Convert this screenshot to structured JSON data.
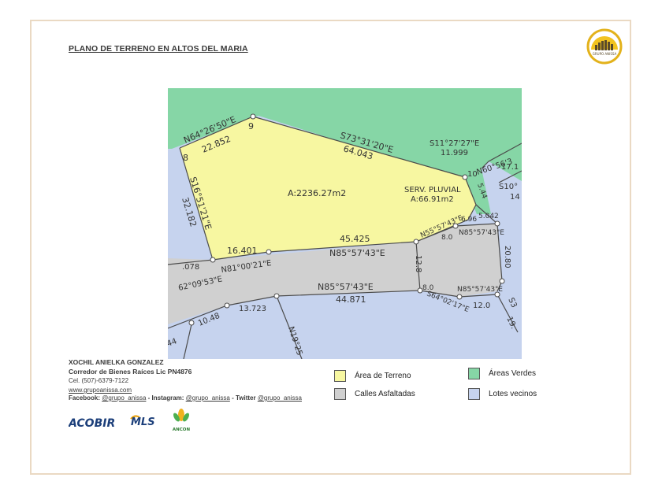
{
  "document": {
    "title": "PLANO DE TERRENO EN ALTOS DEL MARIA",
    "logo_text": "GRUPO ANISSA"
  },
  "map": {
    "colors": {
      "terreno": "#f7f7a1",
      "verdes": "#86d6a6",
      "calles": "#d0d0d0",
      "vecinos": "#c6d3ee",
      "lines": "#4b4b4b"
    },
    "area_label": "A:2236.27m2",
    "serv_pluvial": "SERV. PLUVIAL",
    "serv_area": "A:66.91m2",
    "labels": {
      "n642650": "N64°26'50\"E",
      "d22852": "22.852",
      "p9": "9",
      "p8": "8",
      "s733120": "S73°31'20\"E",
      "d64043": "64.043",
      "s112727": "S11°27'27\"E",
      "d11999": "11.999",
      "p10": "10",
      "n6056": "N60°56'3",
      "d171": "17.1",
      "s10": "S10°",
      "d14": "14",
      "d544": "5.44",
      "d5042": "5.042",
      "s165121": "S16°51'21\"E",
      "d32182": "32.182",
      "d16401": "16.401",
      "d45425": "45.425",
      "n855743a": "N85°57'43\"E",
      "n555743": "N55°57'43\"E",
      "d696": "6.96",
      "d80a": "8.0",
      "n855743b": "N85°57'43\"E",
      "d078": ".078",
      "s620953": "62°09'53\"E",
      "n810021": "N81°00'21\"E",
      "d128": "12.8",
      "d2080": "20.80",
      "n855743c": "N85°57'43\"E",
      "d44871": "44.871",
      "d80b": "8.0",
      "n855743d": "N85°57'43\"E",
      "d13723": "13.723",
      "d1048": "10.48",
      "s640217": "S64°02'17\"E",
      "d120": "12.0",
      "n1925": "N19°25",
      "s3": "S3",
      "d19": "19.",
      "d44": "44"
    }
  },
  "contact": {
    "name": "XOCHIL ANIELKA GONZALEZ",
    "role": "Corredor de Bienes Raíces Lic PN4876",
    "phone": "Cel. (507)-6379-7122",
    "website": "www.grupoanissa.com",
    "facebook_label": "Facebook:",
    "facebook": "@grupo_anissa",
    "instagram_label": "- Instagram:",
    "instagram": "@grupo_anissa",
    "twitter_label": "- Twitter",
    "twitter": "@grupo_anissa"
  },
  "partners": {
    "acobir": "ACOBIR",
    "mls": "MLS",
    "ancon": "ANCON"
  },
  "legend": {
    "terreno": "Área de Terreno",
    "calles": "Calles Asfaltadas",
    "verdes": "Áreas Verdes",
    "vecinos": "Lotes vecinos"
  }
}
